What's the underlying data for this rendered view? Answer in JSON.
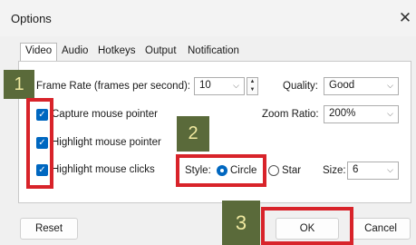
{
  "window": {
    "title": "Options",
    "close_glyph": "✕"
  },
  "tabs": [
    {
      "label": "Video",
      "active": true
    },
    {
      "label": "Audio"
    },
    {
      "label": "Hotkeys"
    },
    {
      "label": "Output"
    },
    {
      "label": "Notification"
    }
  ],
  "frame_rate": {
    "label": "Frame Rate (frames per second):",
    "value": "10"
  },
  "quality": {
    "label": "Quality:",
    "value": "Good"
  },
  "zoom": {
    "label": "Zoom Ratio:",
    "value": "200%"
  },
  "checkboxes": [
    {
      "label": "Capture mouse pointer",
      "checked": true
    },
    {
      "label": "Highlight mouse pointer",
      "checked": true
    },
    {
      "label": "Highlight mouse clicks",
      "checked": true
    }
  ],
  "style": {
    "label": "Style:",
    "options": [
      "Circle",
      "Star"
    ],
    "selected": "Circle"
  },
  "size": {
    "label": "Size:",
    "value": "6"
  },
  "buttons": {
    "reset": "Reset",
    "ok": "OK",
    "cancel": "Cancel"
  },
  "badges": [
    "1",
    "2",
    "3"
  ],
  "colors": {
    "accent": "#0067c0",
    "highlight": "#d8232a",
    "badge_bg": "#5a6a3a",
    "badge_text": "#f0e9a0"
  }
}
